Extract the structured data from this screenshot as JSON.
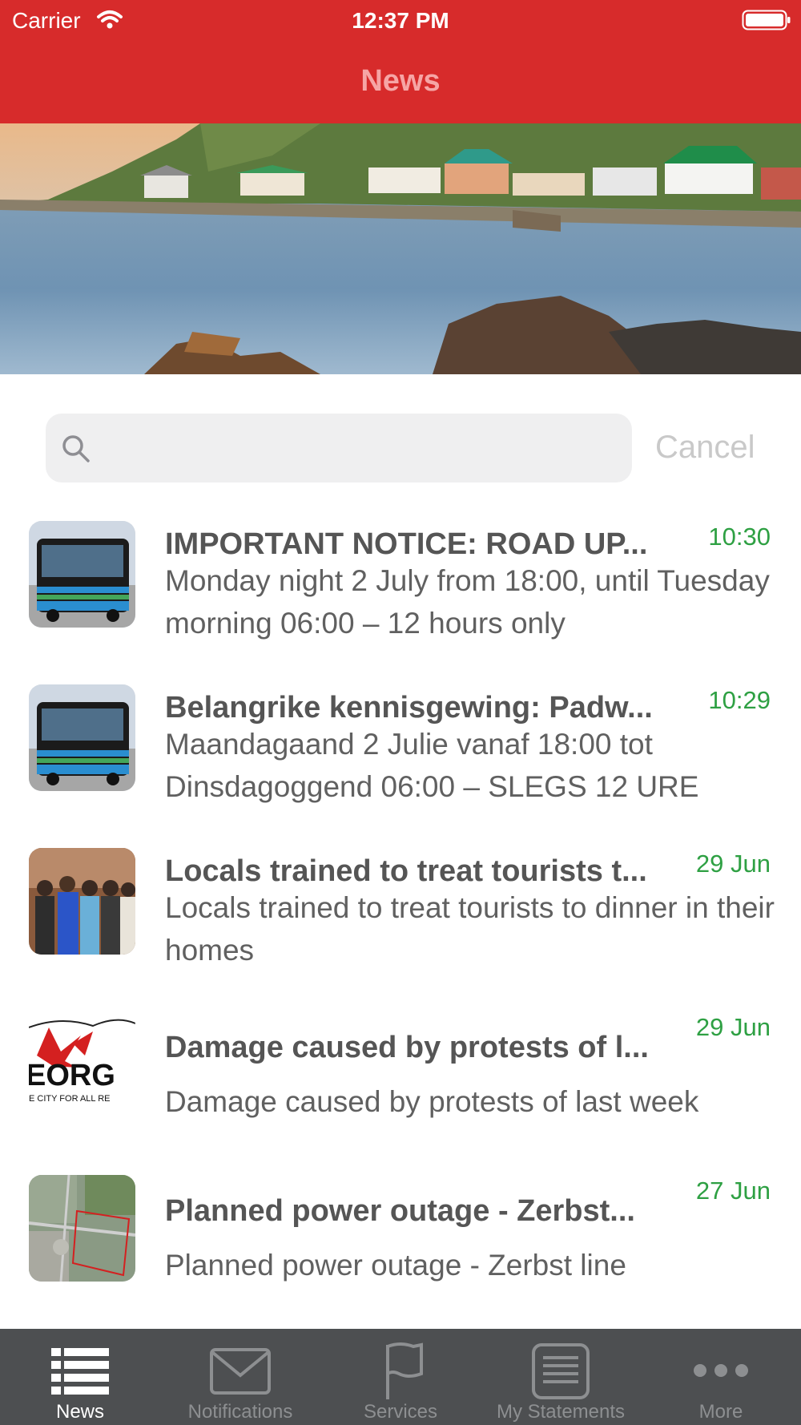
{
  "status_bar": {
    "carrier": "Carrier",
    "time": "12:37 PM",
    "wifi_icon": "wifi-icon",
    "battery_icon": "battery-icon"
  },
  "nav": {
    "title": "News"
  },
  "search": {
    "value": "",
    "placeholder": "",
    "cancel_label": "Cancel",
    "icon": "search-icon"
  },
  "news": [
    {
      "title": "IMPORTANT NOTICE: ROAD UP...",
      "date": "10:30",
      "body": "Monday night 2 July from 18:00, until Tuesday morning 06:00 – 12 hours only",
      "thumb": "bus"
    },
    {
      "title": "Belangrike kennisgewing: Padw...",
      "date": "10:29",
      "body": "Maandagaand 2 Julie vanaf 18:00 tot Dinsdagoggend 06:00 – SLEGS 12 URE",
      "thumb": "bus"
    },
    {
      "title": "Locals trained to treat tourists t...",
      "date": "29 Jun",
      "body": "Locals trained to treat tourists to dinner in their homes",
      "thumb": "group-photo"
    },
    {
      "title": "Damage caused by protests of l...",
      "date": "29 Jun",
      "body": "Damage caused by protests of last week",
      "thumb": "logo",
      "thumb_text": "EORG",
      "thumb_subtext": "E CITY FOR ALL RE"
    },
    {
      "title": "Planned power outage - Zerbst...",
      "date": "27 Jun",
      "body": "Planned power outage - Zerbst line",
      "thumb": "aerial-map"
    }
  ],
  "tabs": [
    {
      "label": "News",
      "icon": "list-icon",
      "active": true
    },
    {
      "label": "Notifications",
      "icon": "envelope-icon",
      "active": false
    },
    {
      "label": "Services",
      "icon": "flag-icon",
      "active": false
    },
    {
      "label": "My Statements",
      "icon": "document-icon",
      "active": false
    },
    {
      "label": "More",
      "icon": "more-dots-icon",
      "active": false
    }
  ],
  "colors": {
    "brand_red": "#d72b2b",
    "nav_title": "#f6a5a5",
    "date_green": "#2ea043",
    "tab_bar": "#4d4f51"
  }
}
